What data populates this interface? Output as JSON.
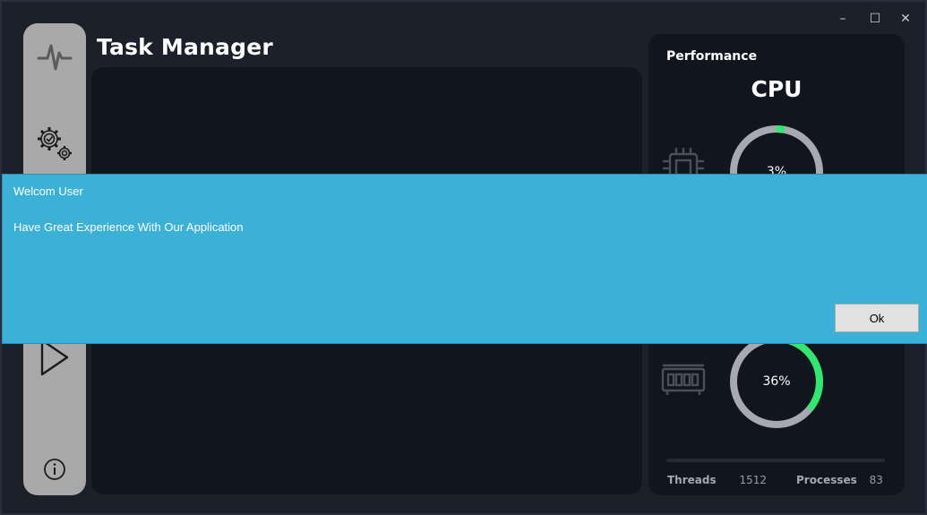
{
  "window": {
    "controls": {
      "minimize": "–",
      "maximize": "☐",
      "close": "✕"
    }
  },
  "app": {
    "title": "Task Manager"
  },
  "sidebar": {
    "icons": [
      "activity-icon",
      "settings-gears-icon",
      "play-icon",
      "info-icon"
    ]
  },
  "performance": {
    "heading": "Performance",
    "cpu": {
      "title": "CPU",
      "percent_label": "3%",
      "percent": 3
    },
    "memory": {
      "percent_label": "36%",
      "percent": 36
    },
    "stats": {
      "threads_label": "Threads",
      "threads_value": "1512",
      "processes_label": "Processes",
      "processes_value": "83"
    }
  },
  "dialog": {
    "title": "Welcom User",
    "message": "Have Great Experience With Our Application",
    "ok_label": "Ok"
  },
  "colors": {
    "accent_green": "#2ee86f",
    "ring_track": "#a7a9ae",
    "dialog_bg": "#3bb1d7"
  }
}
